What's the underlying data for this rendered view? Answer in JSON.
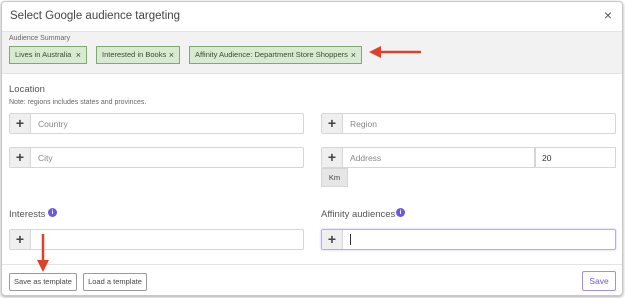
{
  "dialog": {
    "title": "Select Google audience targeting",
    "close_glyph": "×"
  },
  "summary": {
    "label": "Audience Summary",
    "chips": [
      {
        "label": "Lives in Australia",
        "remove_glyph": "×"
      },
      {
        "label": "Interested in Books",
        "remove_glyph": "×"
      },
      {
        "label": "Affinity Audience: Department Store Shoppers",
        "remove_glyph": "×"
      }
    ]
  },
  "location": {
    "title": "Location",
    "note": "Note: regions includes states and provinces.",
    "country": {
      "placeholder": "Country",
      "value": ""
    },
    "region": {
      "placeholder": "Region",
      "value": ""
    },
    "city": {
      "placeholder": "City",
      "value": ""
    },
    "address": {
      "placeholder": "Address",
      "value": ""
    },
    "radius": {
      "value": "20",
      "unit": "Km"
    }
  },
  "interests": {
    "title": "Interests",
    "info_glyph": "i",
    "input": {
      "value": ""
    }
  },
  "affinity": {
    "title": "Affinity audiences",
    "info_glyph": "i",
    "input": {
      "value": ""
    }
  },
  "plus_glyph": "+",
  "footer": {
    "save_template": "Save as template",
    "load_template": "Load a template",
    "save": "Save"
  },
  "colors": {
    "chip_bg": "#d9ead3",
    "chip_border": "#7ea96f",
    "accent": "#6a5ad8",
    "annotation_arrow": "#e0402a"
  }
}
